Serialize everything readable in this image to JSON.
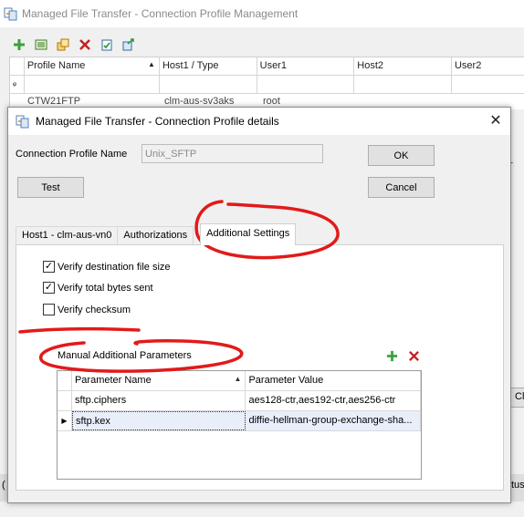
{
  "colors": {
    "annotation_red": "#e21a1a",
    "add_green": "#3aa23a",
    "delete_red": "#c81e1e",
    "selected_row": "#e8eefa"
  },
  "background_window": {
    "title": "Managed File Transfer - Connection Profile Management",
    "toolbar_icons": [
      "add-icon",
      "list-icon",
      "copy-icon",
      "delete-icon",
      "clipboard-check-icon",
      "export-icon"
    ],
    "grid_columns": [
      "Profile Name",
      "Host1 / Type",
      "User1",
      "Host2",
      "User2"
    ],
    "filter_marker": "ᵠ",
    "partial_row": [
      "CTW21FTP",
      "clm-aus-sv3aks",
      "root"
    ],
    "right_partial_text": "r",
    "right_partial_button": "Cl",
    "bottom_left_partial": "(",
    "bottom_right_partial": "tus"
  },
  "dialog": {
    "title": "Managed File Transfer - Connection Profile details",
    "close_glyph": "✕",
    "profile_label": "Connection Profile Name",
    "profile_value": "Unix_SFTP",
    "ok_label": "OK",
    "cancel_label": "Cancel",
    "test_label": "Test",
    "tabs": [
      "Host1 - clm-aus-vn0",
      "Authorizations",
      "Additional Settings"
    ],
    "active_tab": "Additional Settings",
    "checkboxes": [
      {
        "label": "Verify destination file size",
        "checked": true
      },
      {
        "label": "Verify total bytes sent",
        "checked": true
      },
      {
        "label": "Verify checksum",
        "checked": false
      }
    ],
    "check_glyph": "✓",
    "manual_params_label": "Manual Additional Parameters",
    "params_columns": [
      "Parameter Name",
      "Parameter Value"
    ],
    "sort_glyph": "▲",
    "row_pointer": "▶",
    "params_rows": [
      {
        "name": "sftp.ciphers",
        "value": "aes128-ctr,aes192-ctr,aes256-ctr",
        "selected": false
      },
      {
        "name": "sftp.kex",
        "value": "diffie-hellman-group-exchange-sha...",
        "selected": true
      }
    ]
  }
}
